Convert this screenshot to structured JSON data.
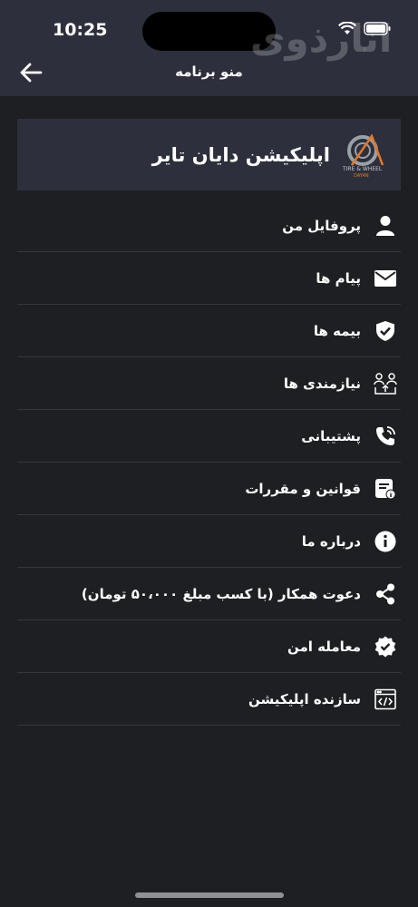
{
  "status_bar": {
    "time": "10:25"
  },
  "watermark": "انارذوی",
  "header": {
    "title": "منو برنامه",
    "back_icon": "arrow-left-icon"
  },
  "app_card": {
    "name": "اپلیکیشن دایان تایر",
    "logo_text": "TIRE & WHEEL",
    "logo_subtext": "DAYAN"
  },
  "menu": {
    "items": [
      {
        "label": "پروفایل من",
        "icon": "user-icon"
      },
      {
        "label": "پیام ها",
        "icon": "envelope-icon"
      },
      {
        "label": "بیمه ها",
        "icon": "shield-check-icon"
      },
      {
        "label": "نیازمندی ها",
        "icon": "users-exchange-icon"
      },
      {
        "label": "پشتیبانی",
        "icon": "phone-ring-icon"
      },
      {
        "label": "قوانین و مقررات",
        "icon": "document-info-icon"
      },
      {
        "label": "درباره ما",
        "icon": "info-circle-icon"
      },
      {
        "label": "دعوت همکار (با کسب مبلغ ۵۰،۰۰۰ تومان)",
        "icon": "share-icon"
      },
      {
        "label": "معامله امن",
        "icon": "verified-badge-icon"
      },
      {
        "label": "سازنده اپلیکیشن",
        "icon": "code-window-icon"
      }
    ]
  },
  "colors": {
    "background": "#1d1f22",
    "surface": "#2d303c",
    "accent": "#e0782a",
    "divider": "#34373d"
  }
}
